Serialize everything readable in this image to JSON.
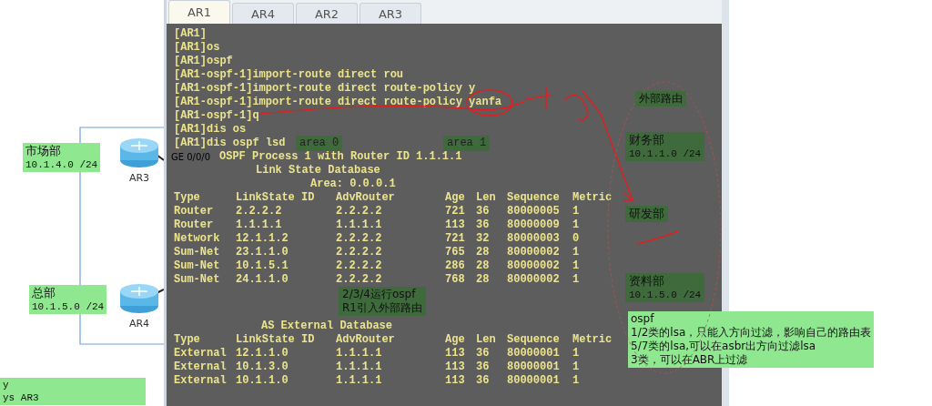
{
  "terminal": {
    "tabs": [
      {
        "label": "AR1",
        "selected": true
      },
      {
        "label": "AR4",
        "selected": false
      },
      {
        "label": "AR2",
        "selected": false
      },
      {
        "label": "AR3",
        "selected": false
      }
    ],
    "commands": [
      "[AR1]",
      "[AR1]os",
      "[AR1]ospf",
      "[AR1-ospf-1]import-route direct rou",
      "[AR1-ospf-1]import-route direct route-policy y",
      "[AR1-ospf-1]import-route direct route-policy yanfa",
      "[AR1-ospf-1]q",
      "[AR1]dis os",
      "[AR1]dis ospf lsd"
    ],
    "lsdb_title": "OSPF Process 1 with Router ID 1.1.1.1",
    "lsdb_subtitle": "Link State Database",
    "area_line": "Area: 0.0.0.1",
    "lsa_columns": [
      "Type",
      "LinkState ID",
      "AdvRouter",
      "Age",
      "Len",
      "Sequence",
      "Metric"
    ],
    "lsa_rows": [
      [
        "Router",
        "2.2.2.2",
        "2.2.2.2",
        "721",
        "36",
        "80000005",
        "1"
      ],
      [
        "Router",
        "1.1.1.1",
        "1.1.1.1",
        "113",
        "36",
        "80000009",
        "1"
      ],
      [
        "Network",
        "12.1.1.2",
        "2.2.2.2",
        "721",
        "32",
        "80000003",
        "0"
      ],
      [
        "Sum-Net",
        "23.1.1.0",
        "2.2.2.2",
        "765",
        "28",
        "80000002",
        "1"
      ],
      [
        "Sum-Net",
        "10.1.5.1",
        "2.2.2.2",
        "286",
        "28",
        "80000002",
        "1"
      ],
      [
        "Sum-Net",
        "24.1.1.0",
        "2.2.2.2",
        "768",
        "28",
        "80000002",
        "1"
      ]
    ],
    "external_title": "AS External Database",
    "external_columns": [
      "Type",
      "LinkState ID",
      "AdvRouter",
      "Age",
      "Len",
      "Sequence",
      "Metric"
    ],
    "external_rows": [
      [
        "External",
        "12.1.1.0",
        "1.1.1.1",
        "113",
        "36",
        "80000001",
        "1"
      ],
      [
        "External",
        "10.1.3.0",
        "1.1.1.1",
        "113",
        "36",
        "80000001",
        "1"
      ],
      [
        "External",
        "10.1.1.0",
        "1.1.1.1",
        "113",
        "36",
        "80000001",
        "1"
      ]
    ]
  },
  "area_labels": [
    "area 0",
    "area 1"
  ],
  "terminal_note": [
    "2/3/4运行ospf",
    "R1引入外部路由"
  ],
  "external_heading": "外部路由",
  "departments": [
    {
      "name": "财务部",
      "subnet": "10.1.1.0 /24"
    },
    {
      "name": "研发部"
    },
    {
      "name": "资料部",
      "subnet": "10.1.5.0 /24"
    }
  ],
  "left_departments": [
    {
      "name": "市场部",
      "subnet": "10.1.4.0 /24"
    },
    {
      "name": "总部",
      "subnet": "10.1.5.0 /24"
    }
  ],
  "routers": [
    {
      "name": "AR3"
    },
    {
      "name": "AR4"
    }
  ],
  "interface_label": "GE 0/0/0",
  "left_note": [
    "y",
    "ys AR3"
  ],
  "ospf_note": [
    "ospf",
    "1/2类的lsa，只能入方向过滤，影响自己的路由表",
    "5/7类的lsa,可以在asbr出方向过滤lsa",
    "3类，可以在ABR上过滤"
  ]
}
